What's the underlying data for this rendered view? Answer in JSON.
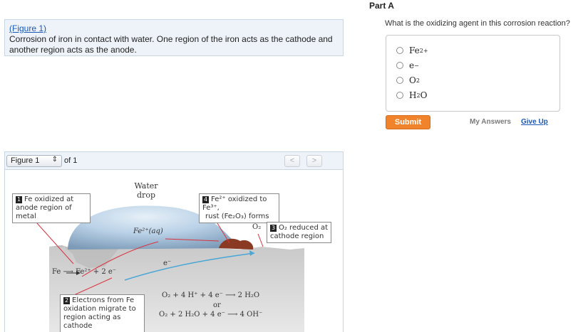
{
  "intro": {
    "figure_link": "(Figure 1)",
    "text": "Corrosion of iron in contact with water. One region of the iron acts as the cathode and another region acts as the anode."
  },
  "figure_panel": {
    "select_value": "Figure 1",
    "of_label": "of 1",
    "prev_label": "<",
    "next_label": ">",
    "labels": {
      "box1_num": "1",
      "box1_text": "Fe oxidized at anode region of metal",
      "water_drop": "Water drop",
      "fe2_aq": "Fe²⁺(aq)",
      "box4_num": "4",
      "box4_line1": "Fe²⁺ oxidized to Fe³⁺,",
      "box4_line2": "rust (Fe₂O₃) forms",
      "o2": "O₂",
      "box3_num": "3",
      "box3_text": "O₂ reduced at cathode region",
      "e_minus": "e⁻",
      "fe_reaction": "Fe ⟶ Fe²⁺ + 2 e⁻",
      "box2_num": "2",
      "box2_text": "Electrons from Fe oxidation migrate to region acting as cathode",
      "eq1": "O₂ + 4 H⁺ + 4 e⁻ ⟶ 2 H₂O",
      "or": "or",
      "eq2": "O₂ + 2 H₂O + 4 e⁻ ⟶ 4 OH⁻"
    }
  },
  "part": {
    "title": "Part A",
    "question": "What is the oxidizing agent in this corrosion reaction?",
    "options": [
      {
        "base": "Fe",
        "sup": "2+",
        "sub": ""
      },
      {
        "base": "e",
        "sup": "−",
        "sub": ""
      },
      {
        "base": "O",
        "sup": "",
        "sub": "2"
      },
      {
        "base": "H",
        "sup": "",
        "sub": "2",
        "tail": "O"
      }
    ],
    "submit_label": "Submit",
    "my_answers_label": "My Answers",
    "give_up_label": "Give Up"
  },
  "colors": {
    "accent_orange": "#f0832b",
    "link_blue": "#1a58b5",
    "panel_bg": "#eef3fa",
    "water_blue": "#a9c8e2"
  }
}
